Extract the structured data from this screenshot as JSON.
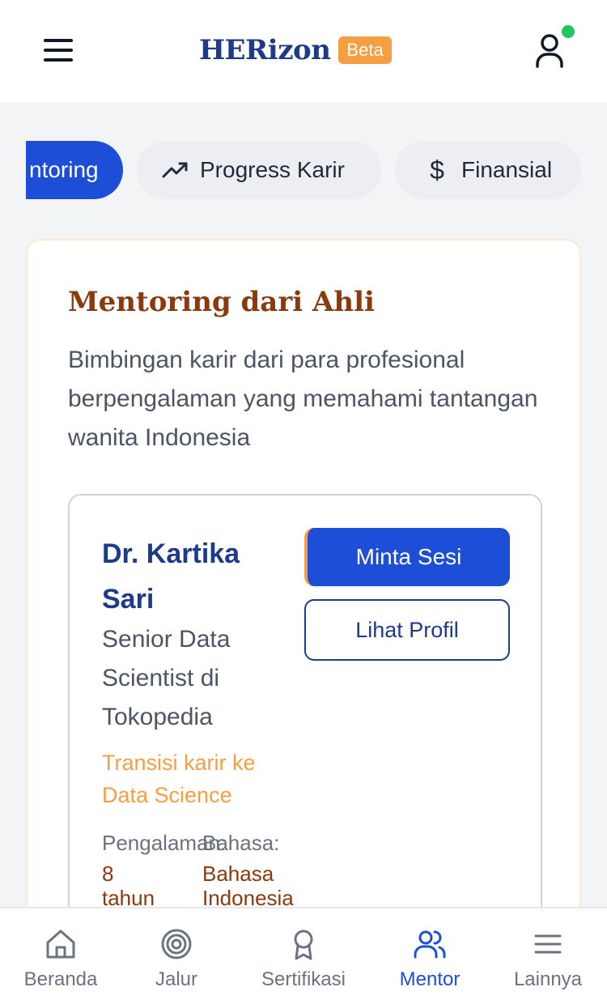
{
  "header": {
    "brand": "HERizon",
    "badge": "Beta"
  },
  "tabs": [
    {
      "label": "ntoring",
      "icon": "mentoring-tab",
      "active": true
    },
    {
      "label": "Progress Karir",
      "icon": "trending-up-icon",
      "active": false
    },
    {
      "label": "Finansial",
      "icon": "dollar-icon",
      "active": false
    }
  ],
  "section": {
    "title": "Mentoring dari Ahli",
    "description": "Bimbingan karir dari para profesional berpengalaman yang memahami tantangan wanita Indonesia"
  },
  "mentor": {
    "name": "Dr. Kartika Sari",
    "role": "Senior Data Scientist di Tokopedia",
    "transition": "Transisi karir ke Data Science",
    "experience_label": "Pengalaman:",
    "experience_value": "8 tahun",
    "language_label": "Bahasa:",
    "language_value": "Bahasa Indonesia",
    "request_button": "Minta Sesi",
    "profile_button": "Lihat Profil"
  },
  "bottom_nav": [
    {
      "label": "Beranda",
      "icon": "home-icon",
      "active": false
    },
    {
      "label": "Jalur",
      "icon": "target-icon",
      "active": false
    },
    {
      "label": "Sertifikasi",
      "icon": "award-icon",
      "active": false
    },
    {
      "label": "Mentor",
      "icon": "users-icon",
      "active": true
    },
    {
      "label": "Lainnya",
      "icon": "menu-icon",
      "active": false
    }
  ],
  "colors": {
    "primary": "#1d4ed8",
    "brand": "#1e3a8a",
    "accent": "#f59e42",
    "title_brown": "#8a3a0c",
    "online": "#22c55e"
  }
}
